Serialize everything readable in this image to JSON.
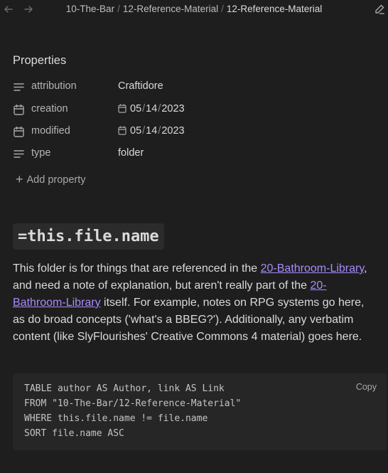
{
  "breadcrumb": {
    "parts": [
      "10-The-Bar",
      "12-Reference-Material"
    ],
    "current": "12-Reference-Material",
    "separator": "/"
  },
  "properties": {
    "title": "Properties",
    "items": [
      {
        "key": "attribution",
        "value": "Craftidore",
        "icon": "text-lines-icon"
      },
      {
        "key": "creation",
        "month": "05",
        "day": "14",
        "year": "2023",
        "icon": "calendar-icon"
      },
      {
        "key": "modified",
        "month": "05",
        "day": "14",
        "year": "2023",
        "icon": "calendar-icon"
      },
      {
        "key": "type",
        "value": "folder",
        "icon": "text-lines-icon"
      }
    ],
    "add_label": "Add property"
  },
  "heading": "=this.file.name",
  "paragraph": {
    "t1": "This folder is for things that are referenced in the ",
    "link1": "20-Bathroom-Library",
    "t2": ", and need a note of explanation, but aren't really part of the ",
    "link2": "20-Bathroom-Library",
    "t3": " itself. For example, notes on RPG systems go here, as do broad concepts ('what's a BBEG?'). Additionally, any verbatim content (like SlyFlourishes' Creative Commons 4 material) goes here."
  },
  "code": {
    "copy_label": "Copy",
    "lines": [
      "TABLE author AS Author, link AS Link",
      "FROM \"10-The-Bar/12-Reference-Material\"",
      "WHERE this.file.name != file.name",
      "SORT file.name ASC"
    ]
  },
  "colors": {
    "background": "#1e1e1e",
    "link": "#a88bfa",
    "code_background": "#262626"
  }
}
